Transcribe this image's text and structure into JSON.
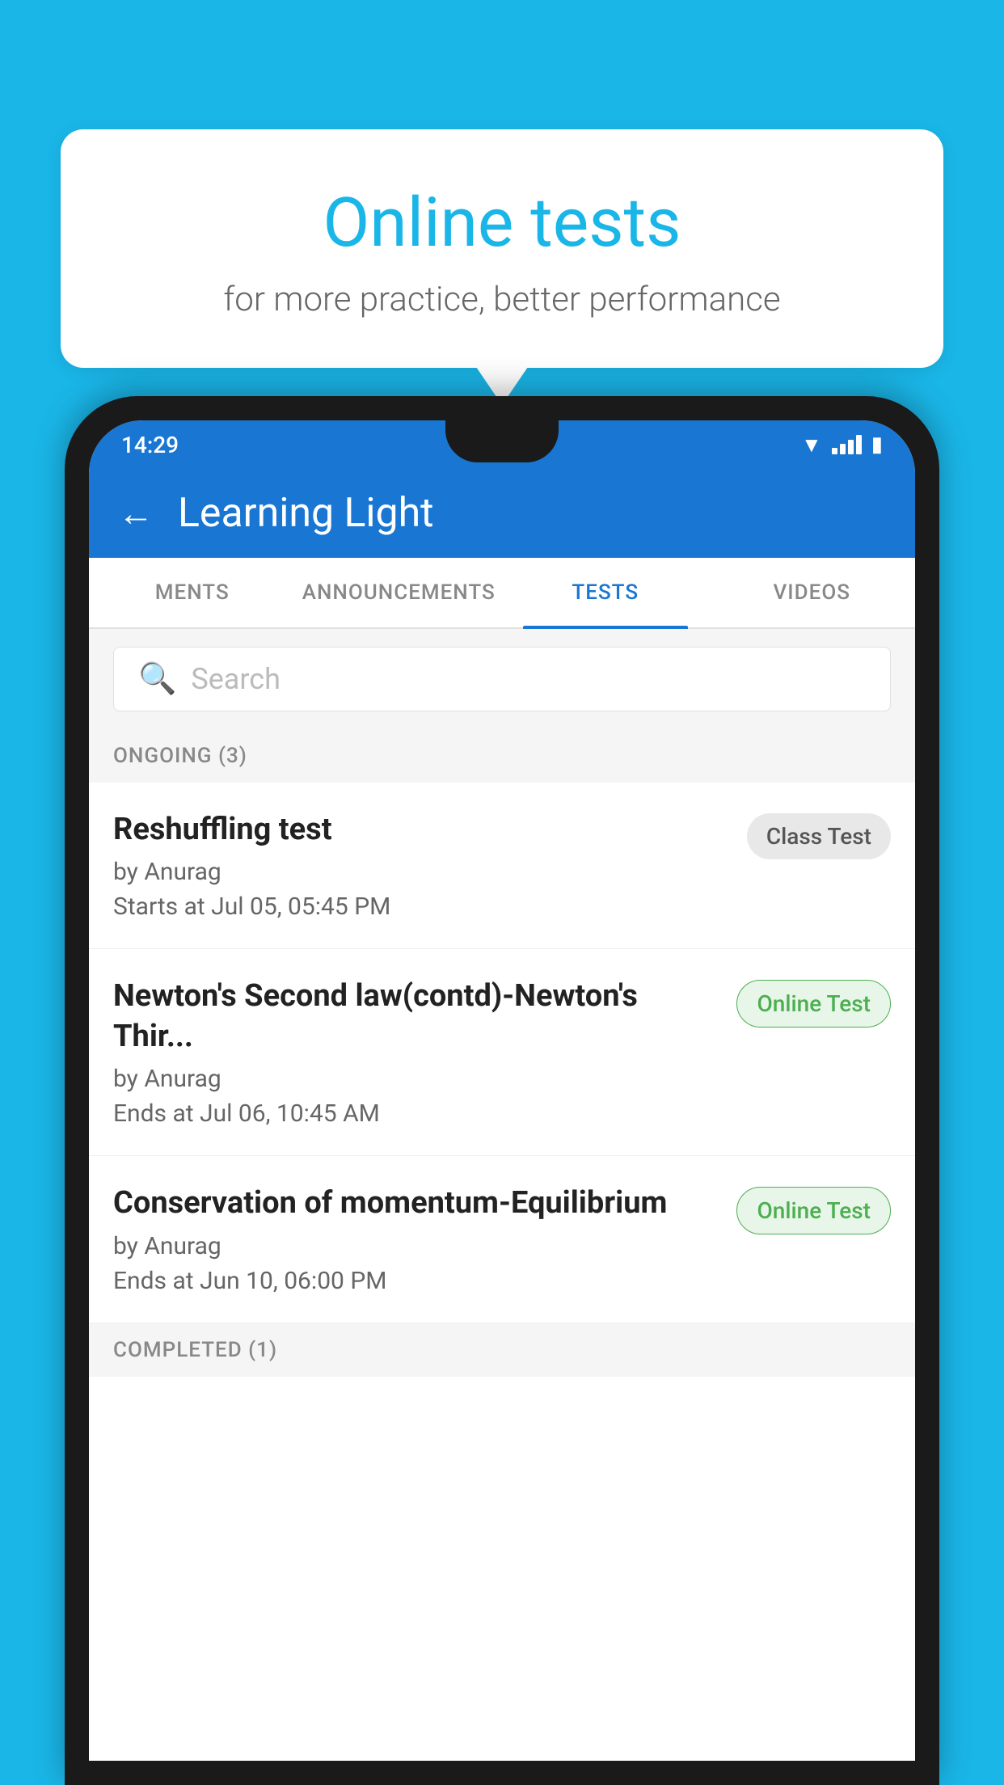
{
  "background": {
    "color": "#1ab6e8"
  },
  "promo": {
    "title": "Online tests",
    "subtitle": "for more practice, better performance"
  },
  "phone": {
    "statusBar": {
      "time": "14:29"
    },
    "appBar": {
      "title": "Learning Light",
      "backLabel": "←"
    },
    "tabs": [
      {
        "label": "MENTS",
        "active": false
      },
      {
        "label": "ANNOUNCEMENTS",
        "active": false
      },
      {
        "label": "TESTS",
        "active": true
      },
      {
        "label": "VIDEOS",
        "active": false
      }
    ],
    "search": {
      "placeholder": "Search"
    },
    "ongoingSection": {
      "title": "ONGOING (3)",
      "tests": [
        {
          "name": "Reshuffling test",
          "author": "by Anurag",
          "time": "Starts at  Jul 05, 05:45 PM",
          "badge": "Class Test",
          "badgeType": "class"
        },
        {
          "name": "Newton's Second law(contd)-Newton's Thir...",
          "author": "by Anurag",
          "time": "Ends at  Jul 06, 10:45 AM",
          "badge": "Online Test",
          "badgeType": "online"
        },
        {
          "name": "Conservation of momentum-Equilibrium",
          "author": "by Anurag",
          "time": "Ends at  Jun 10, 06:00 PM",
          "badge": "Online Test",
          "badgeType": "online"
        }
      ]
    },
    "completedSection": {
      "title": "COMPLETED (1)"
    }
  }
}
